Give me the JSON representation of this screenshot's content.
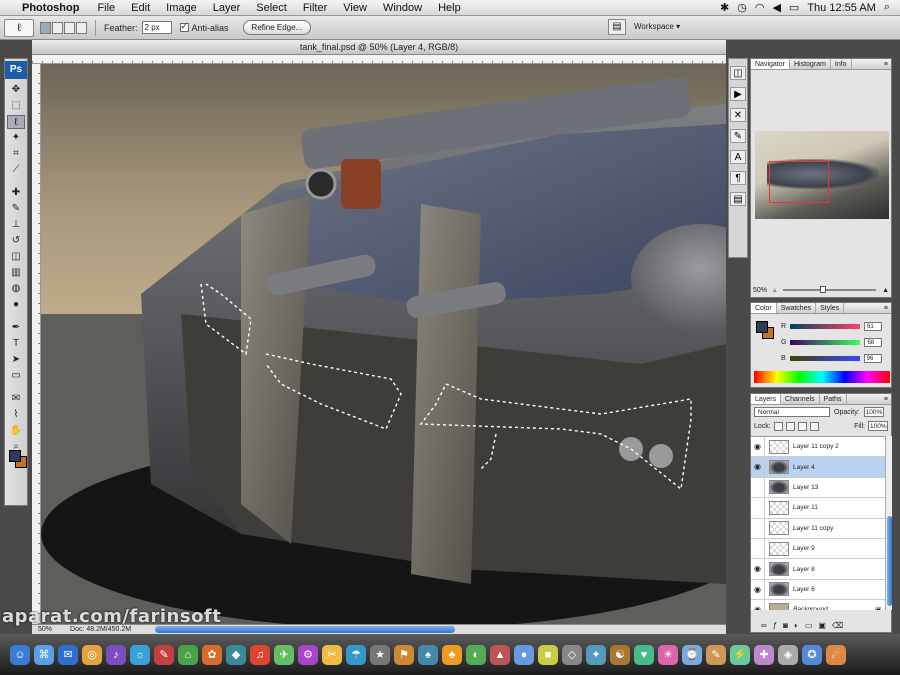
{
  "menubar": {
    "app_name": "Photoshop",
    "items": [
      "File",
      "Edit",
      "Image",
      "Layer",
      "Select",
      "Filter",
      "View",
      "Window",
      "Help"
    ],
    "clock": "Thu 12:55 AM"
  },
  "options_bar": {
    "feather_label": "Feather:",
    "feather_value": "2 px",
    "antialias_label": "Anti-alias",
    "refine_edge_label": "Refine Edge...",
    "workspace_label": "Workspace"
  },
  "toolbox": {
    "logo": "Ps",
    "tools": [
      {
        "name": "move-tool",
        "glyph": "✥"
      },
      {
        "name": "marquee-tool",
        "glyph": "⬚"
      },
      {
        "name": "lasso-tool",
        "glyph": "ℓ"
      },
      {
        "name": "magic-wand-tool",
        "glyph": "✦"
      },
      {
        "name": "crop-tool",
        "glyph": "⌗"
      },
      {
        "name": "slice-tool",
        "glyph": "⟋"
      },
      {
        "name": "healing-brush-tool",
        "glyph": "✚"
      },
      {
        "name": "brush-tool",
        "glyph": "✎"
      },
      {
        "name": "clone-stamp-tool",
        "glyph": "⊥"
      },
      {
        "name": "history-brush-tool",
        "glyph": "↺"
      },
      {
        "name": "eraser-tool",
        "glyph": "◫"
      },
      {
        "name": "gradient-tool",
        "glyph": "▥"
      },
      {
        "name": "blur-tool",
        "glyph": "◍"
      },
      {
        "name": "dodge-tool",
        "glyph": "●"
      },
      {
        "name": "pen-tool",
        "glyph": "✒"
      },
      {
        "name": "type-tool",
        "glyph": "T"
      },
      {
        "name": "path-selection-tool",
        "glyph": "➤"
      },
      {
        "name": "shape-tool",
        "glyph": "▭"
      },
      {
        "name": "notes-tool",
        "glyph": "✉"
      },
      {
        "name": "eyedropper-tool",
        "glyph": "⌇"
      },
      {
        "name": "hand-tool",
        "glyph": "✋"
      },
      {
        "name": "zoom-tool",
        "glyph": "⌕"
      }
    ]
  },
  "document": {
    "title": "tank_final.psd @ 50% (Layer 4, RGB/8)",
    "zoom": "50%",
    "doc_info": "Doc: 48.2M/450.2M"
  },
  "navigator": {
    "tabs": [
      "Navigator",
      "Histogram",
      "Info"
    ],
    "zoom": "50%"
  },
  "color_panel": {
    "tabs": [
      "Color",
      "Swatches",
      "Styles"
    ],
    "r_label": "R",
    "g_label": "G",
    "b_label": "B",
    "r_value": "61",
    "g_value": "68",
    "b_value": "96",
    "fg_color": "#2b3b58",
    "bg_color": "#c27421"
  },
  "layers_panel": {
    "tabs": [
      "Layers",
      "Channels",
      "Paths"
    ],
    "blend_mode": "Normal",
    "opacity_label": "Opacity:",
    "opacity_value": "100%",
    "lock_label": "Lock:",
    "fill_label": "Fill:",
    "fill_value": "100%",
    "layers": [
      {
        "name": "Layer 11 copy 2",
        "visible": true,
        "thumb": "checker",
        "selected": false
      },
      {
        "name": "Layer 4",
        "visible": true,
        "thumb": "tank",
        "selected": true
      },
      {
        "name": "Layer 13",
        "visible": false,
        "thumb": "tank",
        "selected": false
      },
      {
        "name": "Layer 11",
        "visible": false,
        "thumb": "checker",
        "selected": false
      },
      {
        "name": "Layer 11 copy",
        "visible": false,
        "thumb": "checker",
        "selected": false
      },
      {
        "name": "Layer 9",
        "visible": false,
        "thumb": "checker",
        "selected": false
      },
      {
        "name": "Layer 8",
        "visible": true,
        "thumb": "tank",
        "selected": false
      },
      {
        "name": "Layer 6",
        "visible": true,
        "thumb": "tank",
        "selected": false
      },
      {
        "name": "Background",
        "visible": true,
        "thumb": "bg",
        "selected": false,
        "locked": true
      }
    ]
  },
  "watermark": "aparat.com/farinsoft"
}
